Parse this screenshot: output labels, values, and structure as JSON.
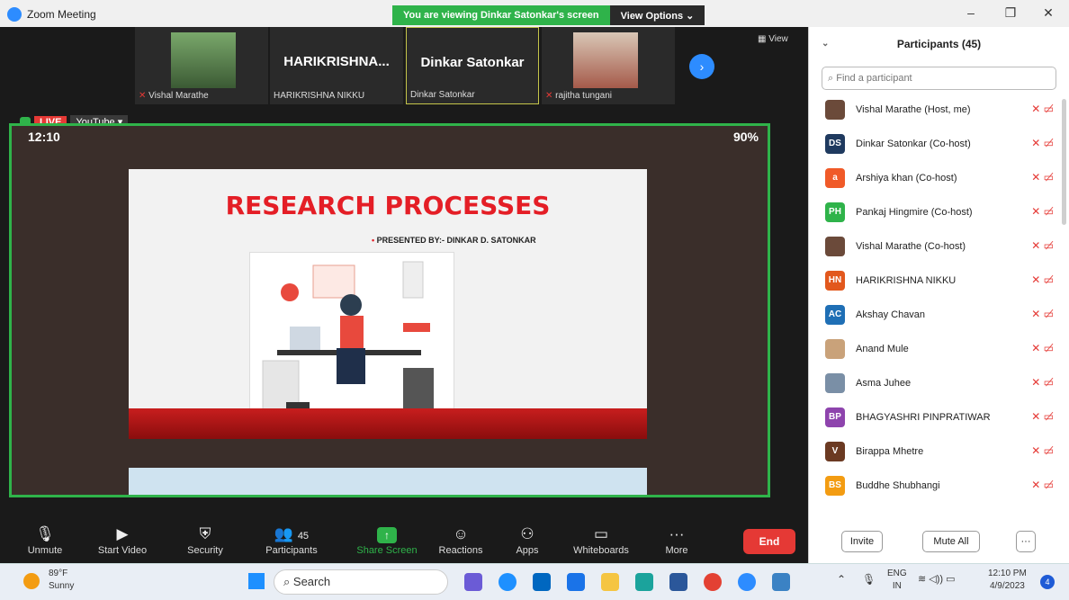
{
  "titlebar": {
    "app_title": "Zoom Meeting",
    "banner_text": "You are viewing Dinkar Satonkar's screen",
    "view_options_label": "View Options",
    "minimize": "–",
    "restore": "❐",
    "close": "✕"
  },
  "thumbnails": [
    {
      "caption": "Vishal Marathe",
      "big": ""
    },
    {
      "caption": "HARIKRISHNA NIKKU",
      "big": "HARIKRISHNA..."
    },
    {
      "caption": "Dinkar Satonkar",
      "big": "Dinkar Satonkar"
    },
    {
      "caption": "rajitha tungani",
      "big": ""
    }
  ],
  "view_label": "View",
  "share": {
    "live_label": "LIVE",
    "youtube_label": "YouTube",
    "phone_time": "12:10",
    "phone_battery": "90%",
    "slide_title": "RESEARCH PROCESSES",
    "slide_subtitle": "PRESENTED BY:- DINKAR D. SATONKAR"
  },
  "toolbar": {
    "unmute": "Unmute",
    "start_video": "Start Video",
    "security": "Security",
    "participants": "Participants",
    "participants_count": "45",
    "share_screen": "Share Screen",
    "reactions": "Reactions",
    "apps": "Apps",
    "whiteboards": "Whiteboards",
    "more": "More",
    "end": "End"
  },
  "panel": {
    "title": "Participants (45)",
    "search_placeholder": "Find a participant",
    "participants": [
      {
        "name": "Vishal Marathe (Host, me)",
        "initials": "",
        "color": "#6b4a3a"
      },
      {
        "name": "Dinkar Satonkar (Co-host)",
        "initials": "DS",
        "color": "#1f3a5f"
      },
      {
        "name": "Arshiya khan (Co-host)",
        "initials": "a",
        "color": "#f05a28"
      },
      {
        "name": "Pankaj Hingmire (Co-host)",
        "initials": "PH",
        "color": "#2fb34a"
      },
      {
        "name": "Vishal Marathe (Co-host)",
        "initials": "",
        "color": "#6b4a3a"
      },
      {
        "name": "HARIKRISHNA NIKKU",
        "initials": "HN",
        "color": "#e2581d"
      },
      {
        "name": "Akshay Chavan",
        "initials": "AC",
        "color": "#1f6fb5"
      },
      {
        "name": "Anand Mule",
        "initials": "",
        "color": "#c9a27a"
      },
      {
        "name": "Asma Juhee",
        "initials": "",
        "color": "#7a8fa6"
      },
      {
        "name": "BHAGYASHRI PINPRATIWAR",
        "initials": "BP",
        "color": "#8e44ad"
      },
      {
        "name": "Birappa Mhetre",
        "initials": "V",
        "color": "#6b3a22"
      },
      {
        "name": "Buddhe Shubhangi",
        "initials": "BS",
        "color": "#f39c12"
      }
    ],
    "invite_label": "Invite",
    "mute_all_label": "Mute All",
    "more_label": "···"
  },
  "taskbar": {
    "temp": "89°F",
    "weather": "Sunny",
    "search_label": "Search",
    "lang": "ENG",
    "region": "IN",
    "time": "12:10 PM",
    "date": "4/9/2023",
    "notifications": "4"
  }
}
